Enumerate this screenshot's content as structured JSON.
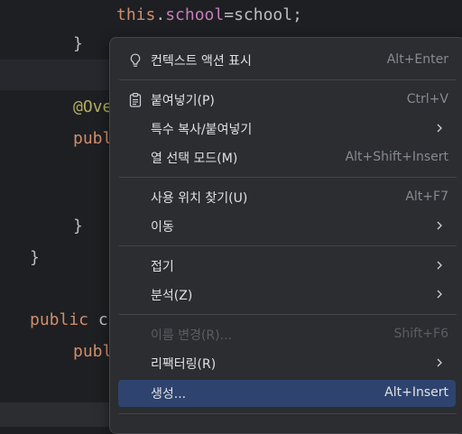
{
  "code": {
    "line1_this": "this",
    "line1_dot": ".",
    "line1_field": "school",
    "line1_rest": "=school;",
    "line2": "}",
    "line3_ann": "@Ove",
    "line4": "publ",
    "line5": "}",
    "line6": "}",
    "line7_kw": "public",
    "line7_rest": " c",
    "line8": "publ"
  },
  "context_menu": {
    "items": [
      {
        "label": "컨텍스트 액션 표시",
        "shortcut": "Alt+Enter",
        "icon": "lightbulb-icon"
      },
      {
        "label": "붙여넣기(P)",
        "shortcut": "Ctrl+V",
        "icon": "clipboard-icon"
      },
      {
        "label": "특수 복사/붙여넣기",
        "submenu": true
      },
      {
        "label": "열 선택 모드(M)",
        "shortcut": "Alt+Shift+Insert"
      },
      {
        "label": "사용 위치 찾기(U)",
        "shortcut": "Alt+F7"
      },
      {
        "label": "이동",
        "submenu": true
      },
      {
        "label": "접기",
        "submenu": true
      },
      {
        "label": "분석(Z)",
        "submenu": true
      },
      {
        "label": "이름 변경(R)...",
        "shortcut": "Shift+F6",
        "disabled": true
      },
      {
        "label": "리팩터링(R)",
        "submenu": true
      },
      {
        "label": "생성...",
        "shortcut": "Alt+Insert",
        "selected": true
      }
    ]
  },
  "colors": {
    "editor_bg": "#1e1f22",
    "menu_bg": "#2b2d30",
    "selection": "#2e436e",
    "keyword": "#cf8e6d",
    "field": "#c77dbb",
    "annotation": "#b3ae60"
  }
}
